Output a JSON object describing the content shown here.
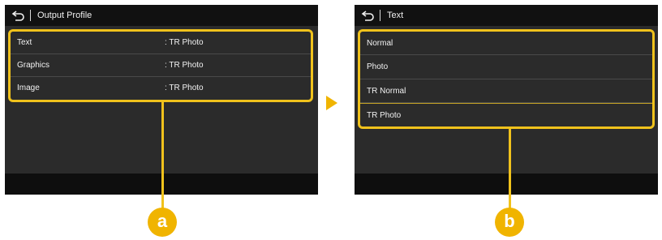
{
  "screen_a": {
    "title": "Output Profile",
    "back_icon": "back-arrow-icon",
    "rows": [
      {
        "label": "Text",
        "value": ": TR Photo"
      },
      {
        "label": "Graphics",
        "value": ": TR Photo"
      },
      {
        "label": "Image",
        "value": ": TR Photo"
      }
    ]
  },
  "screen_b": {
    "title": "Text",
    "back_icon": "back-arrow-icon",
    "options": [
      "Normal",
      "Photo",
      "TR Normal",
      "TR Photo"
    ],
    "selected": "TR Photo"
  },
  "callouts": {
    "a": "a",
    "b": "b"
  },
  "colors": {
    "accent": "#f0b400",
    "panel": "#2b2b2b",
    "bar": "#111111",
    "text": "#f2f2f2"
  }
}
